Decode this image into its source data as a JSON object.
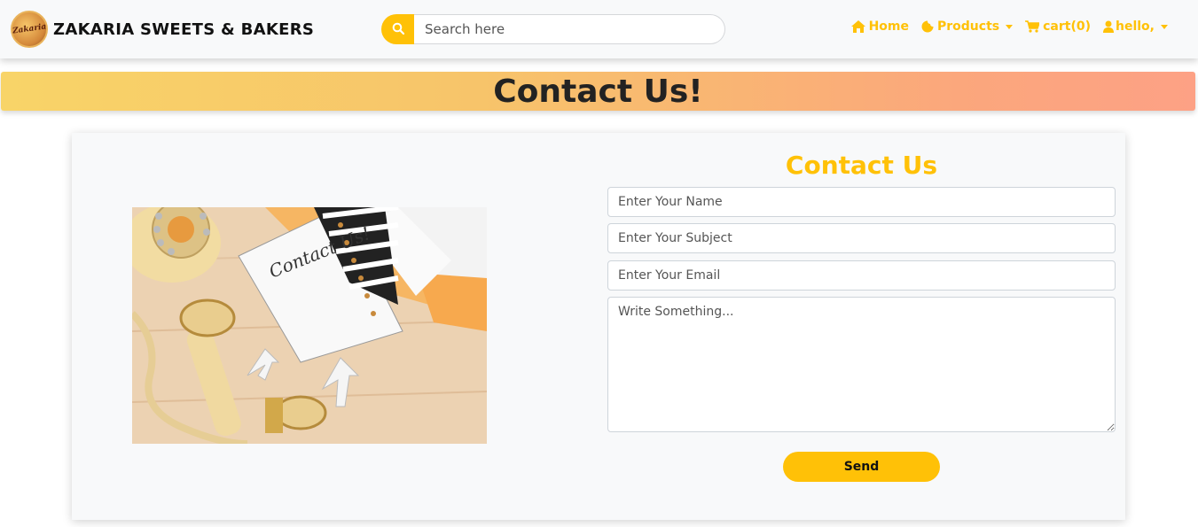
{
  "brand": {
    "logo_text": "Zakaria",
    "name": "ZAKARIA SWEETS & BAKERS"
  },
  "search": {
    "placeholder": "Search here",
    "icon": "search-icon"
  },
  "nav": {
    "home_label": "Home",
    "products_label": "Products",
    "cart_label": "cart(0)",
    "user_label": "hello,",
    "icons": [
      "home-icon",
      "cookie-icon",
      "cart-icon",
      "user-icon"
    ]
  },
  "banner": {
    "title": "Contact Us!"
  },
  "contact_form": {
    "title": "Contact Us",
    "name_placeholder": "Enter Your Name",
    "subject_placeholder": "Enter Your Subject",
    "email_placeholder": "Enter Your Email",
    "message_placeholder": "Write Something...",
    "send_label": "Send"
  },
  "photo": {
    "notebook_text": "Contact Us!"
  },
  "colors": {
    "accent": "#ffc107",
    "navbar_bg": "#f8f9fa",
    "banner_start": "#f8d468",
    "banner_end": "#fda185",
    "text_dark": "#222222"
  }
}
